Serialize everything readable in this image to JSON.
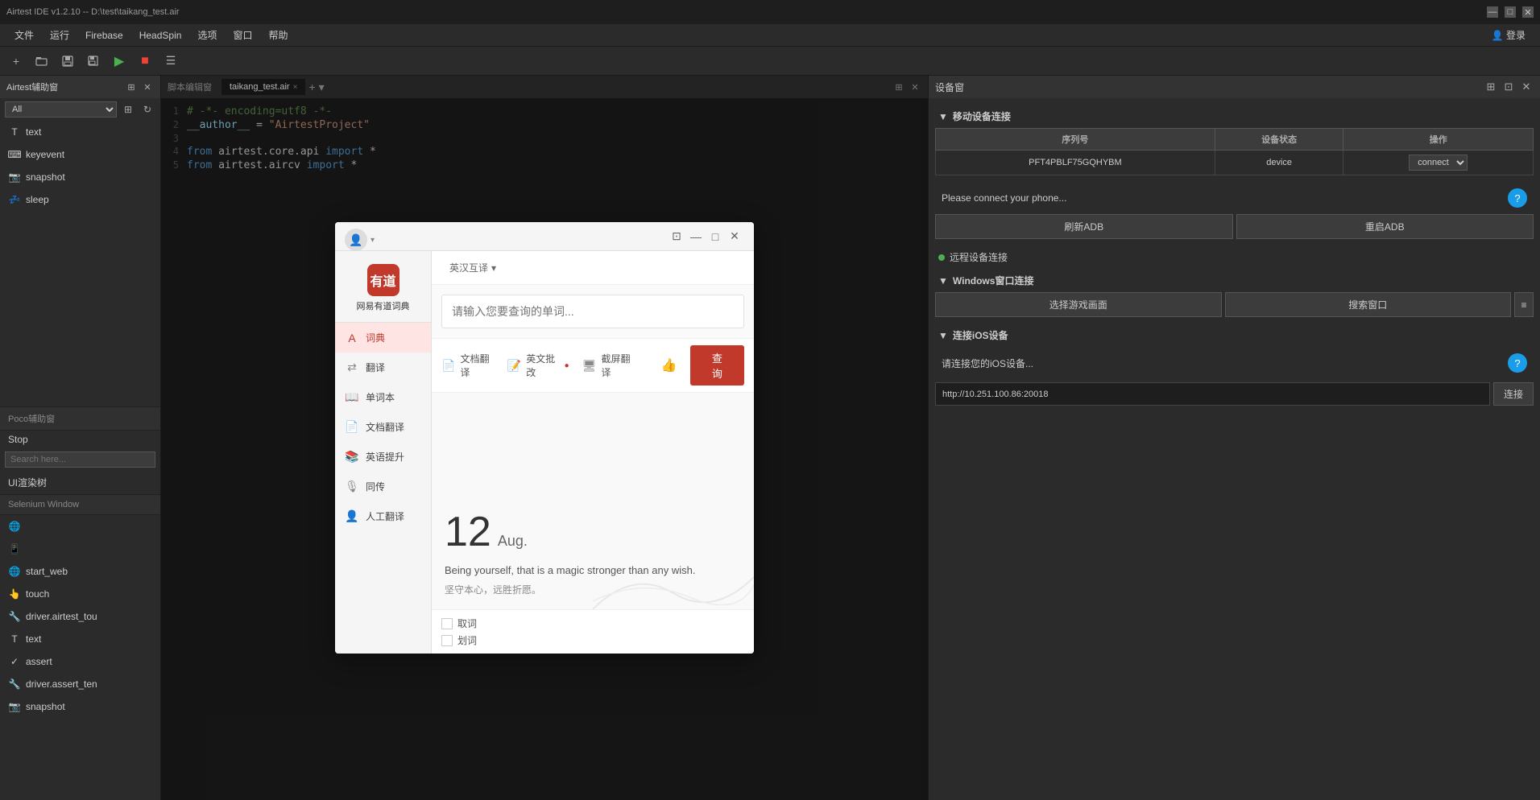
{
  "titlebar": {
    "title": "Airtest IDE v1.2.10 -- D:\\test\\taikang_test.air",
    "min_btn": "—",
    "max_btn": "□",
    "close_btn": "✕"
  },
  "menubar": {
    "items": [
      "文件",
      "运行",
      "Firebase",
      "HeadSpin",
      "选项",
      "窗口",
      "帮助"
    ],
    "login": "登录"
  },
  "toolbar": {
    "new_icon": "+",
    "open_icon": "📁",
    "save_icon": "💾",
    "saveas_icon": "💾",
    "play_icon": "▶",
    "stop_icon": "■",
    "list_icon": "☰"
  },
  "left_panel": {
    "title": "Airtest辅助窗",
    "search_all": "All",
    "items": [
      {
        "icon": "T",
        "label": "text"
      },
      {
        "icon": "⌨",
        "label": "keyevent"
      },
      {
        "icon": "📷",
        "label": "snapshot"
      },
      {
        "icon": "💤",
        "label": "sleep"
      }
    ],
    "poco_title": "Poco辅助窗",
    "stop_label": "Stop",
    "search_placeholder": "Search here...",
    "ui_label": "UI渲染树",
    "selenium_title": "Selenium Window",
    "selenium_items": [
      {
        "icon": "🌐",
        "label": "start_web"
      },
      {
        "icon": "👆",
        "label": "touch"
      },
      {
        "icon": "🔧",
        "label": "driver.airtest_tou"
      },
      {
        "icon": "T",
        "label": "text"
      },
      {
        "icon": "✓",
        "label": "assert"
      },
      {
        "icon": "🔧",
        "label": "driver.assert_ten"
      },
      {
        "icon": "📷",
        "label": "snapshot"
      }
    ]
  },
  "editor": {
    "tab_name": "taikang_test.air",
    "tab_close": "×",
    "lines": [
      {
        "num": 1,
        "code": "# -*- encoding=utf8 -*-"
      },
      {
        "num": 2,
        "code": "__author__ = \"AirtestProject\""
      },
      {
        "num": 3,
        "code": ""
      },
      {
        "num": 4,
        "code": "from airtest.core.api import *"
      },
      {
        "num": 5,
        "code": "from airtest.aircv import *"
      }
    ]
  },
  "device_panel": {
    "title": "设备窗",
    "mobile_section": "▼ 移动设备连接",
    "table_headers": [
      "序列号",
      "设备状态",
      "操作"
    ],
    "table_rows": [
      {
        "serial": "PFT4PBLF75GQHYBM",
        "status": "device",
        "action": "connect"
      }
    ],
    "connect_status": "Please connect your phone...",
    "help_icon": "?",
    "refresh_adb": "刷新ADB",
    "restart_adb": "重启ADB",
    "remote_section": "远程设备连接",
    "windows_section": "▼ Windows窗口连接",
    "select_game": "选择游戏画面",
    "search_window": "搜索窗口",
    "toggle_icon": "≡",
    "ios_section": "▼ 连接iOS设备",
    "ios_connect_text": "请连接您的iOS设备...",
    "ios_help_icon": "?",
    "ios_url": "http://10.251.100.86:20018",
    "ios_connect_btn": "连接"
  },
  "dict_window": {
    "title": "网易有道词典",
    "mode_label": "英汉互译",
    "mode_chevron": "▾",
    "search_placeholder": "请输入您要查询的单词...",
    "action_file_translate": "文档翻译",
    "action_english_batch": "英文批改",
    "action_screen_translate": "截屏翻译",
    "search_btn": "查 询",
    "date_num": "12",
    "date_month": "Aug.",
    "daily_en": "Being yourself, that is a magic stronger than any wish.",
    "daily_cn": "坚守本心，远胜折愿。",
    "check_items": [
      "取词",
      "划词"
    ],
    "sidebar_items": [
      {
        "label": "词典",
        "active": true
      },
      {
        "label": "翻译"
      },
      {
        "label": "单词本"
      },
      {
        "label": "文档翻译"
      },
      {
        "label": "英语提升"
      },
      {
        "label": "同传"
      },
      {
        "label": "人工翻译"
      }
    ],
    "window_controls": [
      "□",
      "—",
      "□",
      "✕"
    ]
  }
}
